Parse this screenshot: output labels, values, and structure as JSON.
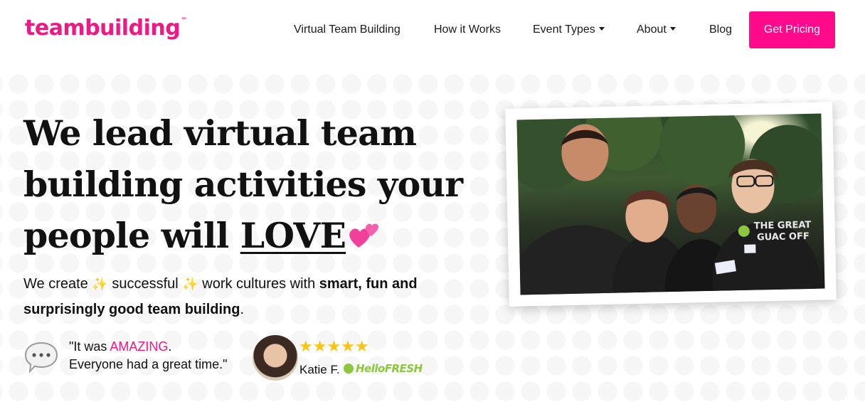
{
  "brand": {
    "logo_text": "teambuilding",
    "trademark": "™",
    "accent_color": "#ed1a85",
    "cta_color": "#ff0a8a"
  },
  "nav": {
    "items": [
      {
        "label": "Virtual Team Building",
        "has_dropdown": false
      },
      {
        "label": "How it Works",
        "has_dropdown": false
      },
      {
        "label": "Event Types",
        "has_dropdown": true
      },
      {
        "label": "About",
        "has_dropdown": true
      },
      {
        "label": "Blog",
        "has_dropdown": false
      }
    ],
    "cta_label": "Get Pricing"
  },
  "hero": {
    "headline_line1": "We lead virtual team",
    "headline_line2": "building activities your",
    "headline_line3_prefix": "people will",
    "headline_emphasis": "LOVE",
    "headline_emoji": "two-hearts-icon",
    "sub_part1": "We create",
    "sub_sparkle": "✨",
    "sub_part2": "successful",
    "sub_part3": "work cultures with",
    "sub_bold": "smart, fun and surprisingly good team building",
    "sub_end": "."
  },
  "testimonial": {
    "quote_open": "\"It was",
    "quote_highlight": "AMAZING",
    "quote_after": ".",
    "quote_line2": "Everyone had a great time.\"",
    "stars": "★★★★★",
    "rating": 5,
    "reviewer": "Katie F.",
    "company_logo_text": "HelloFRESH",
    "icon": "speech-bubble-icon"
  },
  "photo": {
    "shirt_text_1": "THE GREAT",
    "shirt_text_2": "GUAC OFF"
  }
}
